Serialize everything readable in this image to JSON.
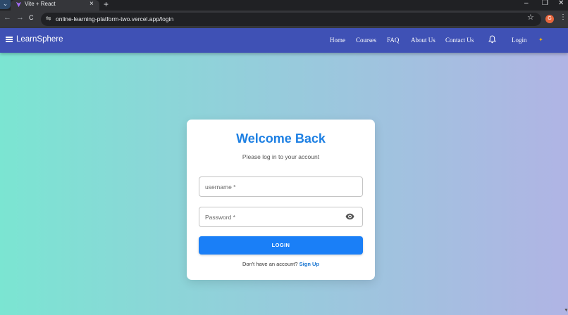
{
  "browser": {
    "tab_title": "Vite + React",
    "tab_close": "×",
    "new_tab": "+",
    "url": "online-learning-platform-two.vercel.app/login",
    "profile_initial": "G",
    "minimize": "–",
    "restore": "❐",
    "close": "✕",
    "tab_menu": "⌄",
    "back": "←",
    "forward": "→",
    "reload": "C",
    "site_info": "⇋",
    "bookmark": "☆",
    "menu": "⋮"
  },
  "appbar": {
    "brand": "LearnSphere",
    "nav": [
      "Home",
      "Courses",
      "FAQ",
      "About Us",
      "Contact Us"
    ],
    "login": "Login"
  },
  "login_card": {
    "title": "Welcome Back",
    "subtitle": "Please log in to your account",
    "username_label": "username *",
    "password_label": "Password *",
    "submit_label": "LOGIN",
    "signup_prompt": "Don't have an account?",
    "signup_link": "Sign Up"
  },
  "colors": {
    "appbar": "#3f51b5",
    "title": "#1e80e3",
    "button": "#1a7ff7",
    "link": "#1976d2",
    "gradient_start": "#7be5d2",
    "gradient_end": "#b0b4e4"
  },
  "icons": [
    "hamburger-icon",
    "bell-icon",
    "eye-icon",
    "sun-icon",
    "star-icon",
    "kebab-icon"
  ]
}
